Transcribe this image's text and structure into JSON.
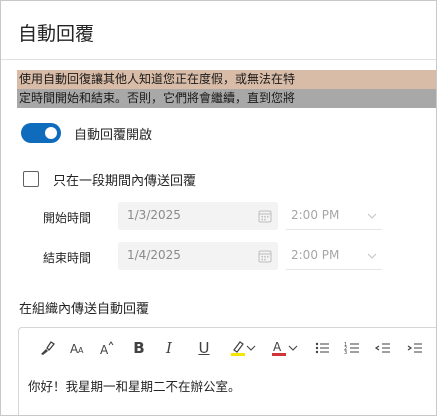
{
  "title": "自動回覆",
  "description": {
    "line1": "使用自動回復讓其他人知道您正在度假，或無法在特",
    "line2": "定時間開始和結束。否則，它們將會繼續，直到您將"
  },
  "toggle": {
    "label": "自動回覆開啟",
    "on": true
  },
  "schedule": {
    "label": "只在一段期間內傳送回覆",
    "checked": false
  },
  "start": {
    "label": "開始時間",
    "date": "1/3/2025",
    "time": "2:00 PM"
  },
  "end": {
    "label": "結束時間",
    "date": "1/4/2025",
    "time": "2:00 PM"
  },
  "inside_org": {
    "label": "在組織內傳送自動回覆",
    "message": "你好！我星期一和星期二不在辦公室。"
  },
  "toolbar": {
    "tools": [
      "format-painter-icon",
      "font-size-decrease-icon",
      "font-size-increase-icon",
      "bold-icon",
      "italic-icon",
      "underline-icon",
      "highlighter-icon",
      "font-color-icon",
      "bullet-list-icon",
      "numbered-list-icon",
      "decrease-indent-icon",
      "increase-indent-icon"
    ],
    "bold": "B",
    "italic": "I",
    "underline": "U",
    "font_color": "A"
  },
  "colors": {
    "accent": "#0f6cbd",
    "highlight_yellow": "#f7e600",
    "font_color_red": "#d13438",
    "line1_bg": "#d9bca7",
    "line2_bg": "#a8a8a8"
  }
}
